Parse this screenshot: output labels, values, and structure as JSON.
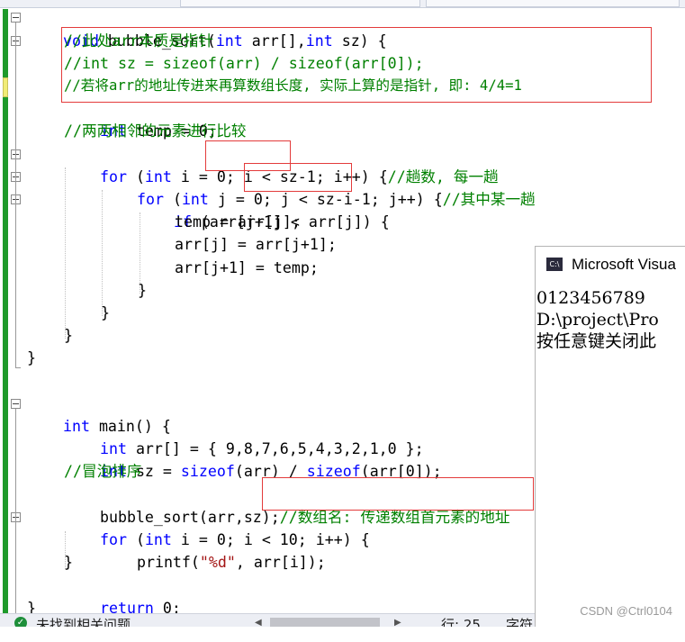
{
  "editor": {
    "lines": [
      {
        "parts": [
          {
            "t": "void",
            "c": "kw"
          },
          {
            "t": " bubble_sort(",
            "c": ""
          },
          {
            "t": "int",
            "c": "kw"
          },
          {
            "t": " arr[],",
            "c": ""
          },
          {
            "t": "int",
            "c": "kw"
          },
          {
            "t": " sz) {",
            "c": ""
          }
        ]
      },
      {
        "parts": [
          {
            "t": "//此处arr本质是指针",
            "c": "cm"
          }
        ]
      },
      {
        "parts": [
          {
            "t": "//int sz = sizeof(arr) / sizeof(arr[0]);",
            "c": "cm"
          }
        ]
      },
      {
        "parts": [
          {
            "t": "//若将arr的地址传进来再算数组长度, 实际上算的是指针, 即: 4/4=1",
            "c": "cm"
          }
        ]
      },
      {
        "parts": [
          {
            "t": "int",
            "c": "kw"
          },
          {
            "t": " temp = 0;",
            "c": ""
          }
        ]
      },
      {
        "parts": [
          {
            "t": "//两两相邻的元素进行比较",
            "c": "cm"
          }
        ]
      },
      {
        "parts": [
          {
            "t": "for",
            "c": "kw"
          },
          {
            "t": " (",
            "c": ""
          },
          {
            "t": "int",
            "c": "kw"
          },
          {
            "t": " i = 0; ",
            "c": ""
          },
          {
            "t": "i < sz-1;",
            "c": ""
          },
          {
            "t": " i++) {",
            "c": ""
          },
          {
            "t": "//趟数, 每一趟",
            "c": "cm"
          }
        ]
      },
      {
        "parts": [
          {
            "t": "for",
            "c": "kw"
          },
          {
            "t": " (",
            "c": ""
          },
          {
            "t": "int",
            "c": "kw"
          },
          {
            "t": " j = 0; ",
            "c": ""
          },
          {
            "t": "j < sz-i-1;",
            "c": ""
          },
          {
            "t": " j++) {",
            "c": ""
          },
          {
            "t": "//其中某一趟",
            "c": "cm"
          }
        ]
      },
      {
        "parts": [
          {
            "t": "if",
            "c": "kw"
          },
          {
            "t": " (arr[j+1] < arr[j]) {",
            "c": ""
          }
        ]
      },
      {
        "parts": [
          {
            "t": "temp = arr[j];",
            "c": ""
          }
        ]
      },
      {
        "parts": [
          {
            "t": "arr[j] = arr[j+1];",
            "c": ""
          }
        ]
      },
      {
        "parts": [
          {
            "t": "arr[j+1] = temp;",
            "c": ""
          }
        ]
      },
      {
        "parts": [
          {
            "t": "}",
            "c": ""
          }
        ]
      },
      {
        "parts": [
          {
            "t": "}",
            "c": ""
          }
        ]
      },
      {
        "parts": [
          {
            "t": "}",
            "c": ""
          }
        ]
      },
      {
        "parts": [
          {
            "t": "}",
            "c": ""
          }
        ]
      },
      {
        "parts": []
      },
      {
        "parts": [
          {
            "t": "int",
            "c": "kw"
          },
          {
            "t": " main() {",
            "c": ""
          }
        ]
      },
      {
        "parts": [
          {
            "t": "int",
            "c": "kw"
          },
          {
            "t": " arr[] = { 9,8,7,6,5,4,3,2,1,0 };",
            "c": ""
          }
        ]
      },
      {
        "parts": [
          {
            "t": "int",
            "c": "kw"
          },
          {
            "t": " sz = ",
            "c": ""
          },
          {
            "t": "sizeof",
            "c": "kw"
          },
          {
            "t": "(arr) / ",
            "c": ""
          },
          {
            "t": "sizeof",
            "c": "kw"
          },
          {
            "t": "(arr[0]);",
            "c": ""
          }
        ]
      },
      {
        "parts": [
          {
            "t": "//冒泡排序",
            "c": "cm"
          }
        ]
      },
      {
        "parts": [
          {
            "t": "bubble_sort(arr,sz);",
            "c": ""
          },
          {
            "t": "//数组名: 传递数组首元素的地址",
            "c": "cm"
          }
        ]
      },
      {
        "parts": [
          {
            "t": "for",
            "c": "kw"
          },
          {
            "t": " (",
            "c": ""
          },
          {
            "t": "int",
            "c": "kw"
          },
          {
            "t": " i = 0; i < 10; i++) {",
            "c": ""
          }
        ]
      },
      {
        "parts": [
          {
            "t": "printf(",
            "c": ""
          },
          {
            "t": "\"%d\"",
            "c": "str"
          },
          {
            "t": ", arr[i]);",
            "c": ""
          }
        ]
      },
      {
        "parts": [
          {
            "t": "}",
            "c": ""
          }
        ]
      },
      {
        "parts": [
          {
            "t": "return",
            "c": "kw"
          },
          {
            "t": " 0;",
            "c": ""
          }
        ]
      },
      {
        "parts": [
          {
            "t": "}",
            "c": ""
          }
        ]
      }
    ]
  },
  "console": {
    "title": "Microsoft Visua",
    "icon": "console-app-icon",
    "output": [
      "0123456789",
      "D:\\project\\Pro",
      "按任意键关闭此"
    ]
  },
  "statusbar": {
    "issues": "未找到相关问题",
    "line_col": "行: 25",
    "encoding": "字符"
  },
  "watermark": "CSDN @Ctrl0104",
  "colors": {
    "keyword": "#0000ff",
    "comment": "#008000",
    "string": "#a31515",
    "highlight": "#e33b3b",
    "gutter_change": "#1e9a2a"
  }
}
